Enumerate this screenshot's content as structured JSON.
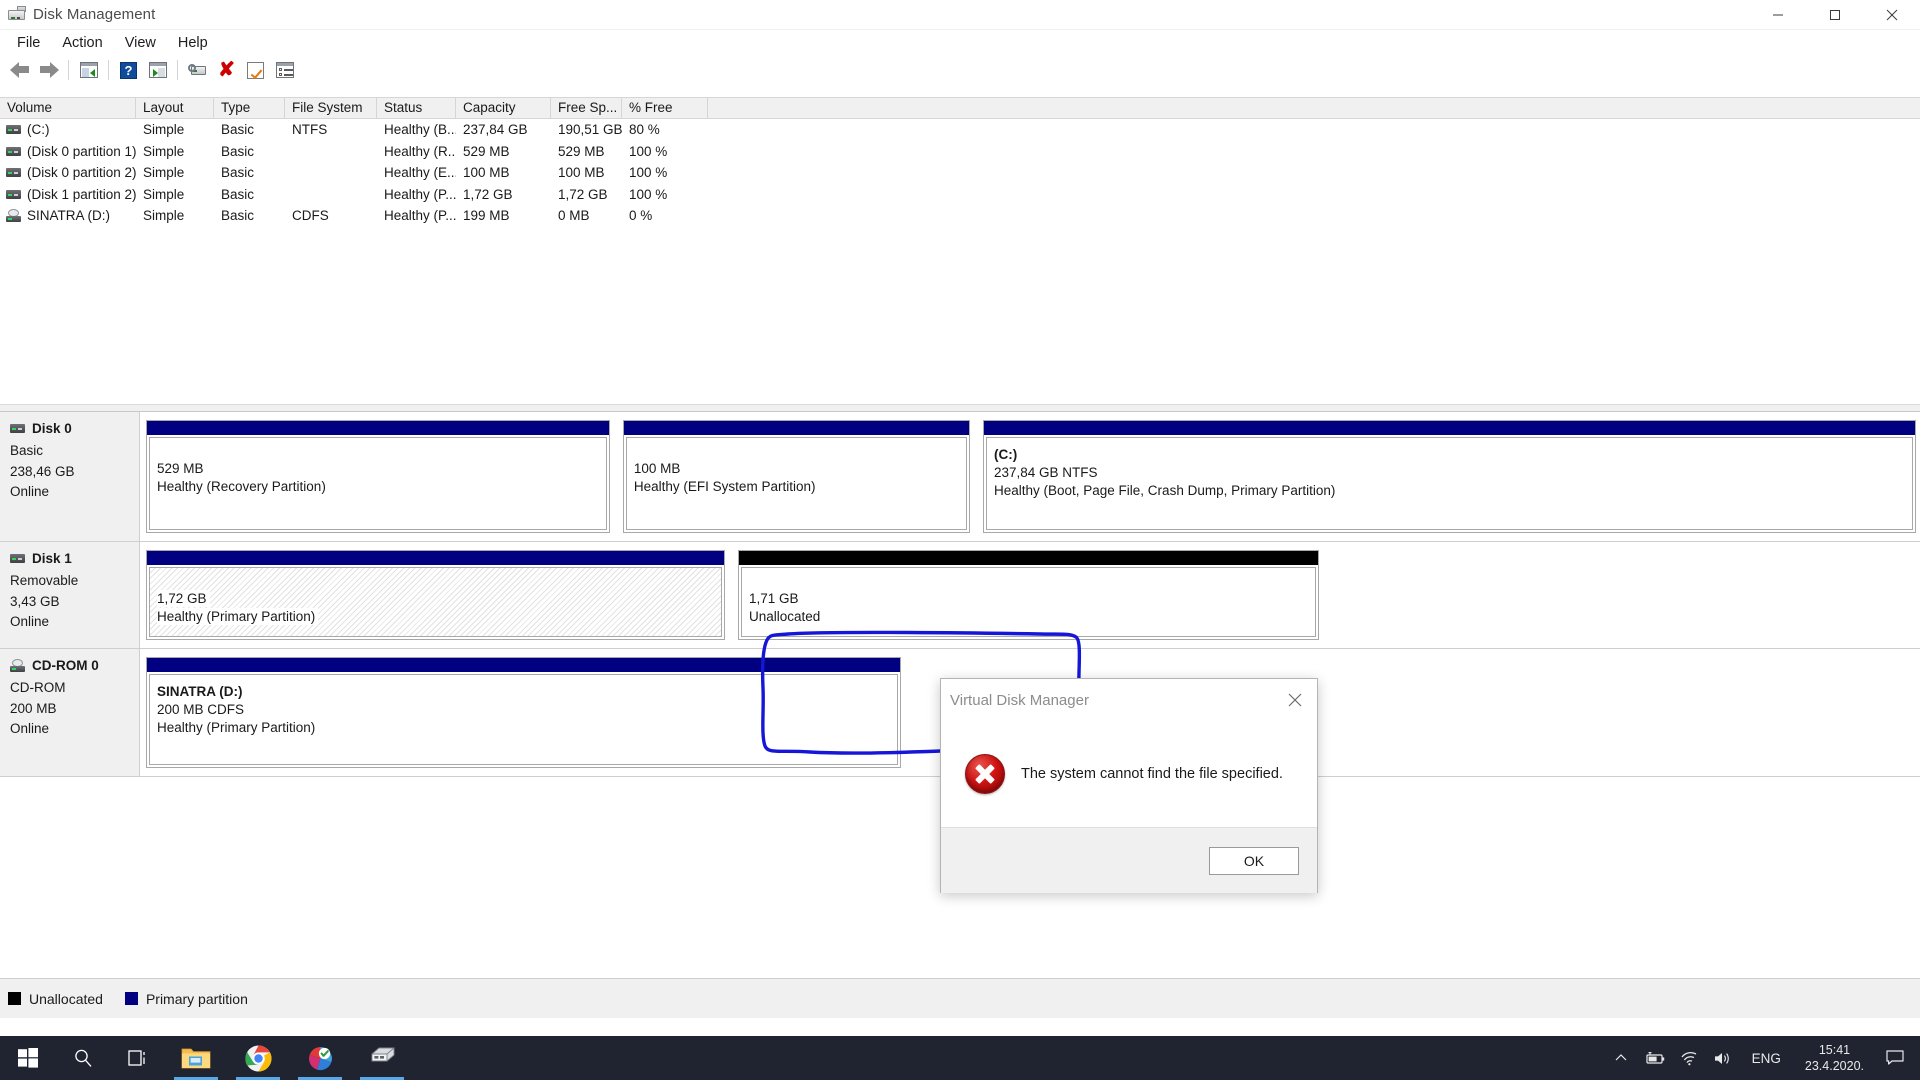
{
  "window": {
    "title": "Disk Management",
    "icon": "disk-management-icon",
    "controls": {
      "minimize": "minimize-icon",
      "maximize": "maximize-icon",
      "close": "close-icon"
    }
  },
  "menubar": {
    "items": [
      "File",
      "Action",
      "View",
      "Help"
    ]
  },
  "toolbar": {
    "buttons": [
      "back-arrow-icon",
      "forward-arrow-icon",
      "show-hide-console-tree-icon",
      "help-icon",
      "show-hide-action-pane-icon",
      "properties-disk-icon",
      "delete-icon",
      "rescan-disks-icon",
      "list-view-icon"
    ]
  },
  "volume_list": {
    "columns": [
      "Volume",
      "Layout",
      "Type",
      "File System",
      "Status",
      "Capacity",
      "Free Sp...",
      "% Free"
    ],
    "rows": [
      {
        "icon": "volume-icon",
        "volume": "(C:)",
        "layout": "Simple",
        "type": "Basic",
        "fs": "NTFS",
        "status": "Healthy (B...",
        "capacity": "237,84 GB",
        "free": "190,51 GB",
        "pctfree": "80 %"
      },
      {
        "icon": "volume-icon",
        "volume": "(Disk 0 partition 1)",
        "layout": "Simple",
        "type": "Basic",
        "fs": "",
        "status": "Healthy (R...",
        "capacity": "529 MB",
        "free": "529 MB",
        "pctfree": "100 %"
      },
      {
        "icon": "volume-icon",
        "volume": "(Disk 0 partition 2)",
        "layout": "Simple",
        "type": "Basic",
        "fs": "",
        "status": "Healthy (E...",
        "capacity": "100 MB",
        "free": "100 MB",
        "pctfree": "100 %"
      },
      {
        "icon": "volume-icon",
        "volume": "(Disk 1 partition 2)",
        "layout": "Simple",
        "type": "Basic",
        "fs": "",
        "status": "Healthy (P...",
        "capacity": "1,72 GB",
        "free": "1,72 GB",
        "pctfree": "100 %"
      },
      {
        "icon": "cdrom-icon",
        "volume": "SINATRA (D:)",
        "layout": "Simple",
        "type": "Basic",
        "fs": "CDFS",
        "status": "Healthy (P...",
        "capacity": "199 MB",
        "free": "0 MB",
        "pctfree": "0 %"
      }
    ]
  },
  "graphical_view": {
    "disks": [
      {
        "name": "Disk 0",
        "icon": "disk-icon",
        "type": "Basic",
        "size": "238,46 GB",
        "status": "Online",
        "partitions": [
          {
            "label": "",
            "size": "529 MB",
            "fs": "",
            "status": "Healthy (Recovery Partition)",
            "bar": "primary",
            "width_pct": 26.6,
            "hatched": false
          },
          {
            "label": "",
            "size": "100 MB",
            "fs": "",
            "status": "Healthy (EFI System Partition)",
            "bar": "primary",
            "width_pct": 19.9,
            "hatched": false
          },
          {
            "label": "(C:)",
            "size": "237,84 GB NTFS",
            "fs": "",
            "status": "Healthy (Boot, Page File, Crash Dump, Primary Partition)",
            "bar": "primary",
            "width_pct": 53.5,
            "hatched": false
          }
        ]
      },
      {
        "name": "Disk 1",
        "icon": "disk-icon",
        "type": "Removable",
        "size": "3,43 GB",
        "status": "Online",
        "partitions": [
          {
            "label": "",
            "size": "1,72 GB",
            "fs": "",
            "status": "Healthy (Primary Partition)",
            "bar": "primary",
            "width_pct": 32.6,
            "hatched": true
          },
          {
            "label": "",
            "size": "1,71 GB",
            "fs": "",
            "status": "Unallocated",
            "bar": "unalloc",
            "width_pct": 32.7,
            "hatched": false
          }
        ]
      },
      {
        "name": "CD-ROM 0",
        "icon": "cdrom-icon",
        "type": "CD-ROM",
        "size": "200 MB",
        "status": "Online",
        "partitions": [
          {
            "label": "SINATRA  (D:)",
            "size": "200 MB CDFS",
            "fs": "",
            "status": "Healthy (Primary Partition)",
            "bar": "primary",
            "width_pct": 42.5,
            "hatched": false
          }
        ]
      }
    ]
  },
  "legend": [
    {
      "label": "Unallocated",
      "color": "#000000"
    },
    {
      "label": "Primary partition",
      "color": "#000080"
    }
  ],
  "dialog": {
    "title": "Virtual Disk Manager",
    "close_icon": "close-icon",
    "error_icon": "error-x-icon",
    "message": "The system cannot find the file specified.",
    "ok_label": "OK"
  },
  "annotation": {
    "shape": "hand-drawn-rectangle",
    "color": "#1616d8"
  },
  "taskbar": {
    "start": "windows-start-icon",
    "items": [
      "search-icon",
      "task-view-icon",
      "file-explorer-icon",
      "chrome-icon",
      "partition-wizard-icon",
      "disk-management-icon"
    ],
    "tray": {
      "chevron": "show-hidden-icons-icon",
      "icons": [
        "battery-icon",
        "wifi-icon",
        "volume-icon"
      ],
      "language": "ENG",
      "time": "15:41",
      "date": "23.4.2020.",
      "notifications": "action-center-icon"
    }
  },
  "colors": {
    "primary_partition": "#000080",
    "unallocated": "#000000",
    "taskbar": "#1f2430",
    "annotation": "#1616d8",
    "error_red": "#cf1111"
  }
}
